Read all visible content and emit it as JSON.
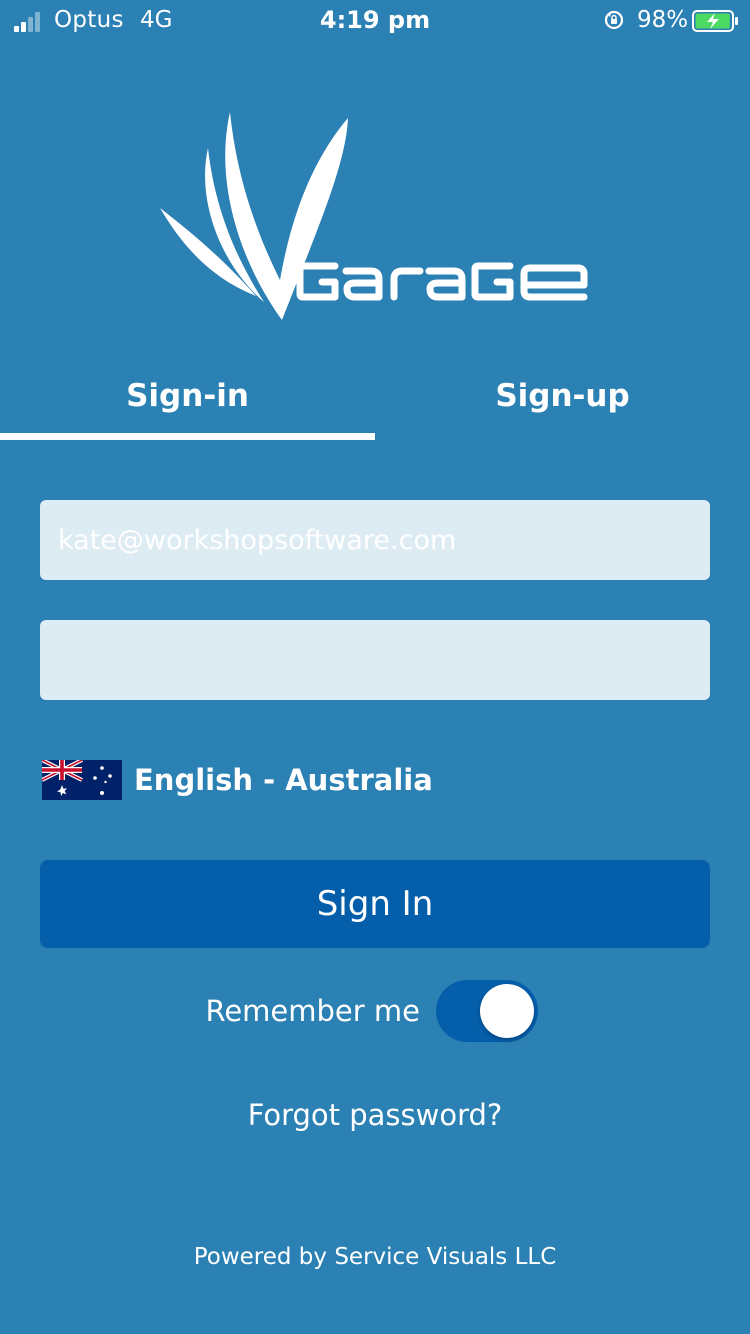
{
  "status_bar": {
    "carrier": "Optus",
    "network": "4G",
    "time": "4:19 pm",
    "battery_percent": "98%",
    "signal_bars_active": 2,
    "signal_bars_total": 4,
    "battery_level": 0.98,
    "battery_color": "#4cd964"
  },
  "brand": {
    "logo_icon": "garage-logo",
    "logo_text": "Garage"
  },
  "tabs": [
    {
      "label": "Sign-in",
      "active": true
    },
    {
      "label": "Sign-up",
      "active": false
    }
  ],
  "form": {
    "email_placeholder": "kate@workshopsoftware.com",
    "password_placeholder": "",
    "language_label": "English - Australia",
    "language_flag": "australia-flag-icon",
    "signin_label": "Sign In",
    "remember_label": "Remember me",
    "remember_checked": true,
    "forgot_label": "Forgot password?"
  },
  "footer": {
    "powered_by": "Powered by Service Visuals LLC"
  },
  "colors": {
    "background": "#2b80b4",
    "field_bg": "#ddebf3",
    "primary_button": "#045eaa",
    "text": "#ffffff"
  }
}
